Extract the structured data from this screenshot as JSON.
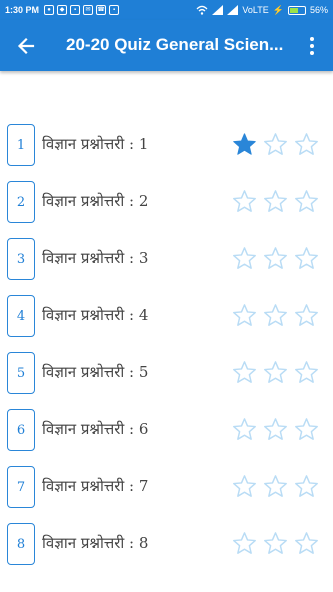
{
  "status_bar": {
    "time": "1:30 PM",
    "network": "VoLTE",
    "battery_percent": "56%",
    "battery_level": 0.56
  },
  "app_bar": {
    "title": "20-20 Quiz General Scien...",
    "color": "#1f7fd6"
  },
  "quizzes": [
    {
      "number": "1",
      "label": "विज्ञान प्रश्नोत्तरी : 1",
      "stars_filled": 1,
      "stars_total": 3
    },
    {
      "number": "2",
      "label": "विज्ञान प्रश्नोत्तरी : 2",
      "stars_filled": 0,
      "stars_total": 3
    },
    {
      "number": "3",
      "label": "विज्ञान प्रश्नोत्तरी : 3",
      "stars_filled": 0,
      "stars_total": 3
    },
    {
      "number": "4",
      "label": "विज्ञान प्रश्नोत्तरी : 4",
      "stars_filled": 0,
      "stars_total": 3
    },
    {
      "number": "5",
      "label": "विज्ञान प्रश्नोत्तरी : 5",
      "stars_filled": 0,
      "stars_total": 3
    },
    {
      "number": "6",
      "label": "विज्ञान प्रश्नोत्तरी : 6",
      "stars_filled": 0,
      "stars_total": 3
    },
    {
      "number": "7",
      "label": "विज्ञान प्रश्नोत्तरी : 7",
      "stars_filled": 0,
      "stars_total": 3
    },
    {
      "number": "8",
      "label": "विज्ञान प्रश्नोत्तरी : 8",
      "stars_filled": 0,
      "stars_total": 3
    }
  ],
  "colors": {
    "accent": "#1f7fd6",
    "star_filled": "#2a86d8",
    "star_empty": "#b9dcf5"
  }
}
